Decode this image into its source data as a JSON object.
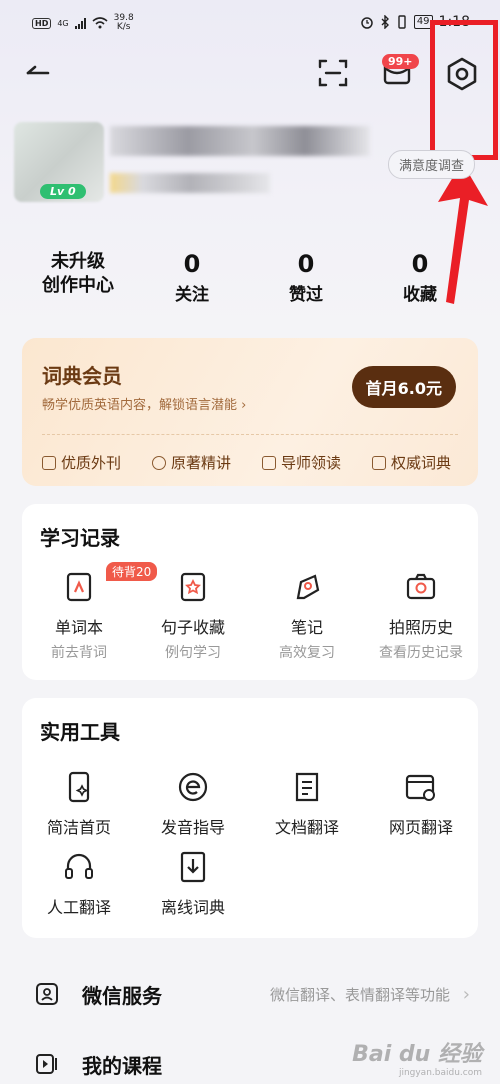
{
  "status_bar": {
    "hd": "HD",
    "net": "4G",
    "speed_value": "39.8",
    "speed_unit": "K/s",
    "battery": "49",
    "time": "1:18"
  },
  "header": {
    "badge": "99+"
  },
  "profile": {
    "level": "Lv 0",
    "survey": "满意度调查"
  },
  "stats": [
    {
      "line1": "未升级",
      "line2": "创作中心"
    },
    {
      "num": "0",
      "label": "关注"
    },
    {
      "num": "0",
      "label": "赞过"
    },
    {
      "num": "0",
      "label": "收藏"
    }
  ],
  "vip": {
    "title": "词典会员",
    "subtitle": "畅学优质英语内容，解锁语言潜能",
    "cta": "首月6.0元",
    "features": [
      "优质外刊",
      "原著精讲",
      "导师领读",
      "权威词典"
    ]
  },
  "study": {
    "title": "学习记录",
    "badge": "待背20",
    "items": [
      {
        "name": "单词本",
        "sub": "前去背词"
      },
      {
        "name": "句子收藏",
        "sub": "例句学习"
      },
      {
        "name": "笔记",
        "sub": "高效复习"
      },
      {
        "name": "拍照历史",
        "sub": "查看历史记录"
      }
    ]
  },
  "tools": {
    "title": "实用工具",
    "items": [
      {
        "name": "简洁首页"
      },
      {
        "name": "发音指导"
      },
      {
        "name": "文档翻译"
      },
      {
        "name": "网页翻译"
      },
      {
        "name": "人工翻译"
      },
      {
        "name": "离线词典"
      }
    ]
  },
  "rows": [
    {
      "title": "微信服务",
      "sub": "微信翻译、表情翻译等功能"
    },
    {
      "title": "我的课程",
      "sub": ""
    }
  ],
  "watermark": {
    "brand": "Bai du 经验",
    "url": "jingyan.baidu.com"
  },
  "colors": {
    "accent": "#f05a4a",
    "vip_dark": "#5a2e10",
    "annotation_red": "#ea1f26"
  }
}
